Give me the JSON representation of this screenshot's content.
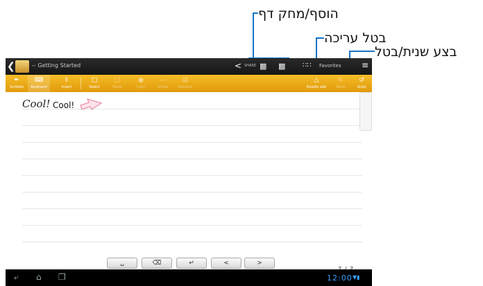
{
  "callouts": {
    "add_delete_page": "הוסף/מחק דף",
    "cancel_edit": "בטל עריכה",
    "redo_undo": "בצע שנית/בטל"
  },
  "topbar": {
    "back_icon": "back-arrow-icon",
    "title": "-- Getting Started",
    "share_label": "SHARE",
    "favorites_label": "Favorites"
  },
  "toolbar": {
    "scribble": "Scribble",
    "keyboard": "Keyboard",
    "insert": "Insert",
    "select": "Select",
    "paste": "Paste",
    "color": "Color",
    "stroke": "Stroke",
    "baseline": "Baseline",
    "doodle_edit": "Doodle edit",
    "redo": "Redo",
    "undo": "Undo"
  },
  "page": {
    "handwritten_text": "Cool!",
    "typed_text": "Cool!",
    "page_number": "7 / 7"
  },
  "keyboard_buttons": [
    "space-key",
    "backspace-key",
    "enter-key",
    "left-arrow-key",
    "right-arrow-key"
  ],
  "sysbar": {
    "clock": "12:00"
  },
  "colors": {
    "toolbar_orange": "#f0aa17",
    "callout_blue": "#1a73c5"
  }
}
